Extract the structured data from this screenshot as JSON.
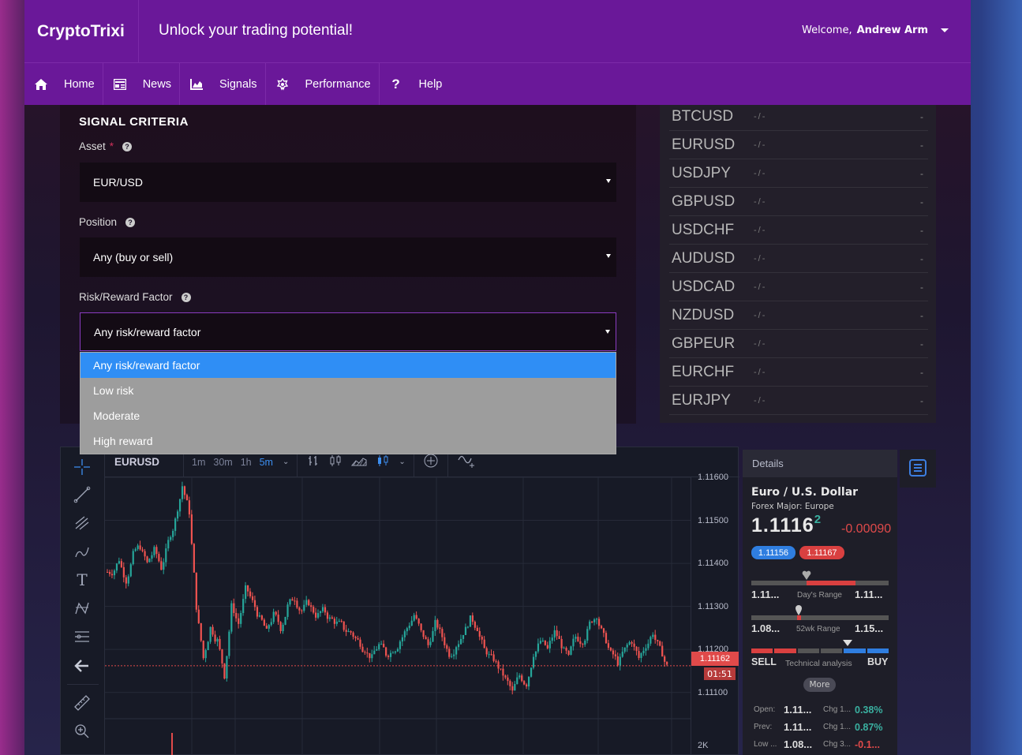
{
  "header": {
    "brand": "CryptoTrixi",
    "tagline": "Unlock your trading potential!",
    "welcome_prefix": "Welcome,",
    "user_name": "Andrew Arm"
  },
  "nav": [
    {
      "label": "Home",
      "icon": "home-icon"
    },
    {
      "label": "News",
      "icon": "newspaper-icon"
    },
    {
      "label": "Signals",
      "icon": "area-chart-icon"
    },
    {
      "label": "Performance",
      "icon": "gear-star-icon"
    },
    {
      "label": "Help",
      "icon": "question-icon"
    }
  ],
  "criteria": {
    "title": "SIGNAL CRITERIA",
    "asset_label": "Asset",
    "asset_required": "*",
    "asset_value": "EUR/USD",
    "position_label": "Position",
    "position_value": "Any (buy or sell)",
    "risk_label": "Risk/Reward Factor",
    "risk_value": "Any risk/reward factor",
    "risk_options": [
      "Any risk/reward factor",
      "Low risk",
      "Moderate",
      "High reward"
    ]
  },
  "ticker": [
    {
      "symbol": "BTCUSD",
      "value": "-/-",
      "change": "-"
    },
    {
      "symbol": "EURUSD",
      "value": "-/-",
      "change": "-"
    },
    {
      "symbol": "USDJPY",
      "value": "-/-",
      "change": "-"
    },
    {
      "symbol": "GBPUSD",
      "value": "-/-",
      "change": "-"
    },
    {
      "symbol": "USDCHF",
      "value": "-/-",
      "change": "-"
    },
    {
      "symbol": "AUDUSD",
      "value": "-/-",
      "change": "-"
    },
    {
      "symbol": "USDCAD",
      "value": "-/-",
      "change": "-"
    },
    {
      "symbol": "NZDUSD",
      "value": "-/-",
      "change": "-"
    },
    {
      "symbol": "GBPEUR",
      "value": "-/-",
      "change": "-"
    },
    {
      "symbol": "EURCHF",
      "value": "-/-",
      "change": "-"
    },
    {
      "symbol": "EURJPY",
      "value": "-/-",
      "change": "-"
    }
  ],
  "chart": {
    "symbol": "EURUSD",
    "timeframes": [
      "1m",
      "30m",
      "1h",
      "5m"
    ],
    "selected_timeframe": "5m",
    "y_labels": [
      "1.11600",
      "1.11500",
      "1.11400",
      "1.11300",
      "1.11200",
      "1.11100"
    ],
    "current_price": "1.11162",
    "countdown": "01:51",
    "volume_label": "2K",
    "colors": {
      "up": "#26a69a",
      "down": "#ef5350"
    }
  },
  "chart_data": {
    "type": "candlestick",
    "ylim": [
      1.1105,
      1.116
    ],
    "close": [
      1.1138,
      1.1141,
      1.1136,
      1.1142,
      1.1144,
      1.114,
      1.1143,
      1.1139,
      1.1145,
      1.115,
      1.1158,
      1.1152,
      1.113,
      1.1118,
      1.1125,
      1.1122,
      1.1114,
      1.113,
      1.1126,
      1.1134,
      1.1131,
      1.1127,
      1.1124,
      1.1128,
      1.1125,
      1.113,
      1.1132,
      1.1129,
      1.1131,
      1.1128,
      1.1129,
      1.1127,
      1.1126,
      1.1125,
      1.1124,
      1.1122,
      1.112,
      1.1118,
      1.1121,
      1.1119,
      1.112,
      1.1122,
      1.1125,
      1.1128,
      1.1124,
      1.1121,
      1.1126,
      1.1123,
      1.1119,
      1.1121,
      1.1124,
      1.1127,
      1.1125,
      1.112,
      1.1118,
      1.1116,
      1.1113,
      1.111,
      1.1114,
      1.1112,
      1.1119,
      1.1122,
      1.112,
      1.1124,
      1.1121,
      1.1118,
      1.1123,
      1.1122,
      1.1126,
      1.1128,
      1.1123,
      1.1119,
      1.1117,
      1.112,
      1.1122,
      1.1118,
      1.1121,
      1.1124,
      1.112,
      1.1116
    ]
  },
  "details": {
    "title": "Details",
    "name": "Euro / U.S. Dollar",
    "subtitle": "Forex Major: Europe",
    "price_main": "1.1116",
    "price_sup": "2",
    "change": "-0.00090",
    "bid": "1.11156",
    "ask": "1.11167",
    "days_low": "1.11...",
    "days_label": "Day's Range",
    "days_high": "1.11...",
    "wk_low": "1.08...",
    "wk_label": "52wk Range",
    "wk_high": "1.15...",
    "sell": "SELL",
    "tech_label": "Technical analysis",
    "buy": "BUY",
    "more": "More",
    "stats": [
      {
        "label": "Open:",
        "value": "1.11...",
        "clabel": "Chg 1...",
        "pct": "0.38%",
        "color": "#3ab0a0"
      },
      {
        "label": "Prev:",
        "value": "1.11...",
        "clabel": "Chg 1...",
        "pct": "0.87%",
        "color": "#3ab0a0"
      },
      {
        "label": "Low ...",
        "value": "1.08...",
        "clabel": "Chg 3...",
        "pct": "-0.1...",
        "color": "#e04a4a"
      }
    ]
  }
}
